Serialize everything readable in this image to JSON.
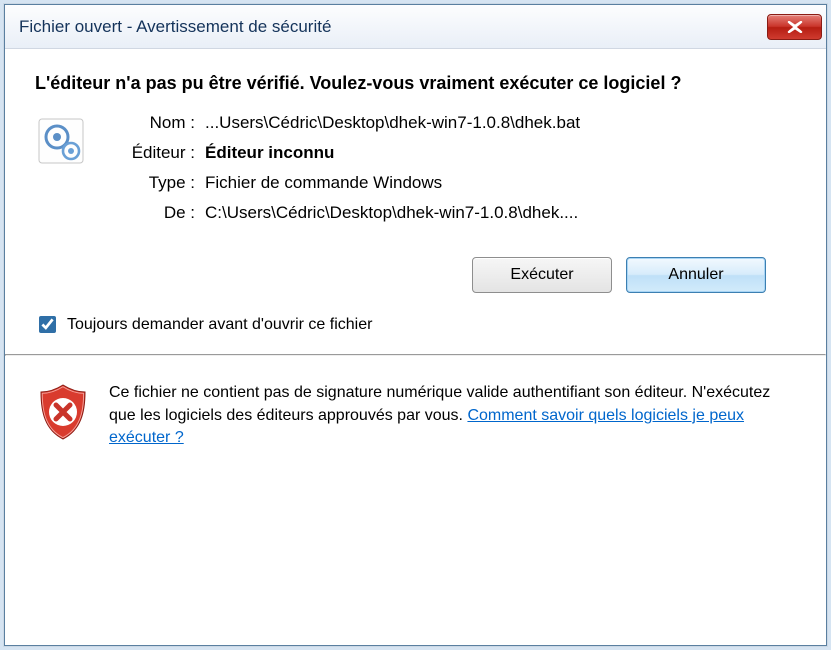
{
  "title": "Fichier ouvert - Avertissement de sécurité",
  "heading": "L'éditeur n'a pas pu être vérifié. Voulez-vous vraiment exécuter ce logiciel ?",
  "fields": {
    "name_label": "Nom :",
    "name_value": "...Users\\Cédric\\Desktop\\dhek-win7-1.0.8\\dhek.bat",
    "publisher_label": "Éditeur :",
    "publisher_value": "Éditeur inconnu",
    "type_label": "Type :",
    "type_value": "Fichier de commande Windows",
    "from_label": "De :",
    "from_value": "C:\\Users\\Cédric\\Desktop\\dhek-win7-1.0.8\\dhek...."
  },
  "buttons": {
    "execute": "Exécuter",
    "cancel": "Annuler"
  },
  "checkbox": {
    "label": "Toujours demander avant d'ouvrir ce fichier",
    "checked": true
  },
  "warning": {
    "text_before": "Ce fichier ne contient pas de signature numérique valide authentifiant son éditeur. N'exécutez que les logiciels des éditeurs approuvés par vous. ",
    "link": "Comment savoir quels logiciels je peux exécuter ?"
  }
}
